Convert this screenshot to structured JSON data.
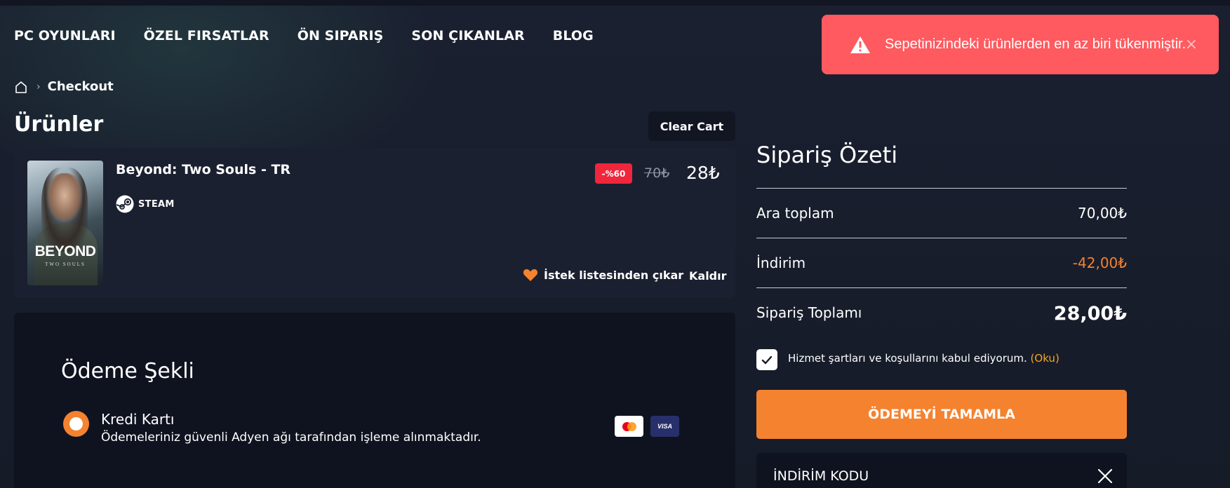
{
  "nav": {
    "items": [
      "PC OYUNLARI",
      "ÖZEL FIRSATLAR",
      "ÖN SIPARIŞ",
      "SON ÇIKANLAR",
      "BLOG"
    ]
  },
  "toast": {
    "message": "Sepetinizindeki ürünlerden en az biri tükenmiştir.",
    "close": "×",
    "icon": "warning-icon",
    "color": "#ff5a5f"
  },
  "breadcrumb": {
    "home_icon": "home-icon",
    "separator": "›",
    "current": "Checkout"
  },
  "cart": {
    "title": "Ürünler",
    "clear_label": "Clear Cart",
    "product": {
      "name": "Beyond: Two Souls - TR",
      "cover_title": "BEYOND",
      "cover_subtitle": "TWO SOULS",
      "platform": "STEAM",
      "discount": "-%60",
      "old_price": "70₺",
      "price": "28₺",
      "wishlist_label": "İstek listesinden çıkar",
      "remove_label": "Kaldır"
    }
  },
  "payment": {
    "title": "Ödeme Şekli",
    "method": {
      "title": "Kredi Kartı",
      "description": "Ödemeleriniz güvenli Adyen ağı tarafından işleme alınmaktadır.",
      "selected": true,
      "cards": [
        "mastercard",
        "VISA"
      ]
    }
  },
  "summary": {
    "title": "Sipariş Özeti",
    "subtotal_label": "Ara toplam",
    "subtotal_value": "70,00₺",
    "discount_label": "İndirim",
    "discount_value": "-42,00₺",
    "total_label": "Sipariş Toplamı",
    "total_value": "28,00₺",
    "terms_text": "Hizmet şartları ve koşullarını kabul ediyorum.",
    "terms_link": "(Oku)",
    "terms_checked": true,
    "checkout_label": "ÖDEMEYİ TAMAMLA",
    "coupon_label": "İNDİRİM KODU"
  },
  "colors": {
    "accent": "#f5822f",
    "badge": "#f0263c",
    "background": "#151a27"
  }
}
